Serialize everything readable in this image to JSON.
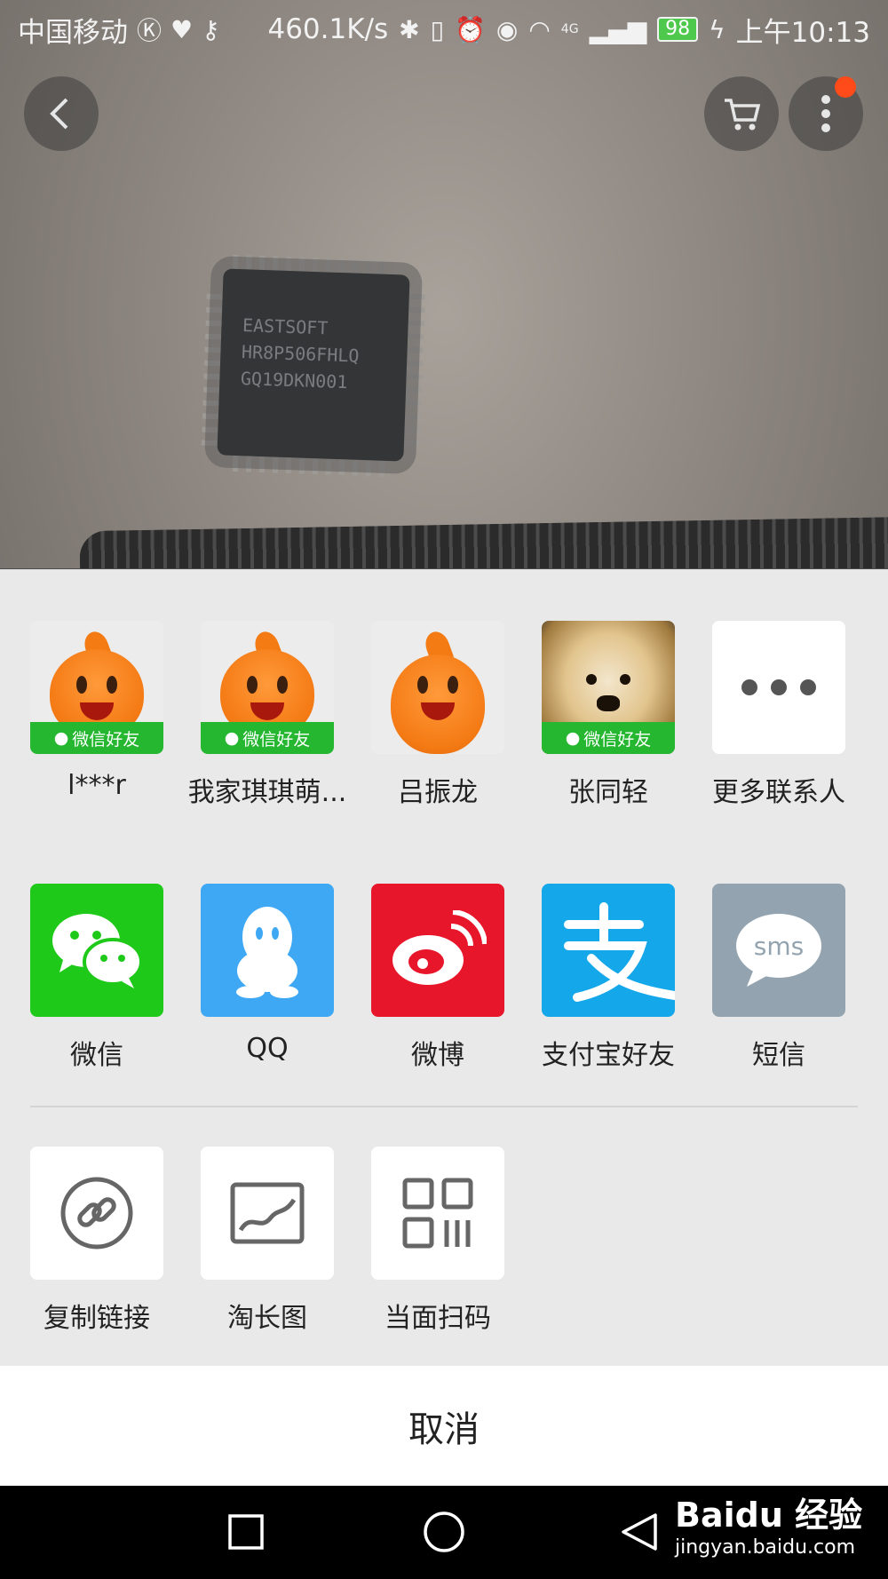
{
  "status_bar": {
    "carrier": "中国移动",
    "speed": "460.1K/s",
    "network": "4G",
    "battery": "98",
    "time": "上午10:13"
  },
  "top_actions": {
    "back_icon": "chevron-left-icon",
    "cart_icon": "cart-icon",
    "more_icon": "more-vertical-icon"
  },
  "chip_marking": [
    "EASTSOFT",
    "HR8P506FHLQ",
    "GQ19DKN001"
  ],
  "share_sheet": {
    "contacts": [
      {
        "name": "l***r",
        "badge": "微信好友",
        "avatar": "orange-mascot"
      },
      {
        "name": "我家琪琪萌...",
        "badge": "微信好友",
        "avatar": "orange-mascot"
      },
      {
        "name": "吕振龙",
        "badge": "",
        "avatar": "orange-mascot"
      },
      {
        "name": "张同轻",
        "badge": "微信好友",
        "avatar": "dog-photo"
      },
      {
        "name": "更多联系人",
        "badge": "",
        "avatar": "more-dots"
      }
    ],
    "apps": [
      {
        "name": "微信",
        "icon": "wechat-icon",
        "color": "#1fc919"
      },
      {
        "name": "QQ",
        "icon": "qq-icon",
        "color": "#3ea8f4"
      },
      {
        "name": "微博",
        "icon": "weibo-icon",
        "color": "#e8162a"
      },
      {
        "name": "支付宝好友",
        "icon": "alipay-icon",
        "color": "#14a7ea"
      },
      {
        "name": "短信",
        "icon": "sms-icon",
        "color": "#93a4b0",
        "icon_text": "sms"
      }
    ],
    "utilities": [
      {
        "name": "复制链接",
        "icon": "link-icon"
      },
      {
        "name": "淘长图",
        "icon": "image-icon"
      },
      {
        "name": "当面扫码",
        "icon": "qr-code-icon"
      }
    ],
    "cancel": "取消"
  },
  "watermark": {
    "main": "Baidu 经验",
    "sub": "jingyan.baidu.com"
  }
}
